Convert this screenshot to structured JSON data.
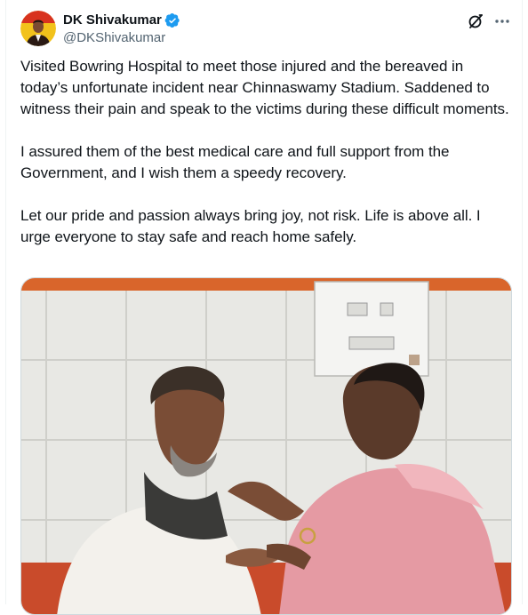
{
  "tweet": {
    "author": {
      "display_name": "DK Shivakumar",
      "handle": "@DKShivakumar",
      "verified": true
    },
    "text": "Visited Bowring Hospital to meet those injured and the bereaved in today’s unfortunate incident near Chinnaswamy Stadium. Saddened to witness their pain and speak to the victims during these difficult moments.\n\nI assured them of the best medical care and full support from the Government, and I wish them a speedy recovery.\n\nLet our pride and passion always bring joy, not risk. Life is above all. I urge everyone to stay safe and reach home safely.",
    "media": {
      "type": "photo",
      "icon": "photo-image"
    }
  },
  "icons": {
    "verified": "verified-badge-icon",
    "grok": "grok-icon",
    "more": "more-options-icon"
  },
  "colors": {
    "text_primary": "#0f1419",
    "text_secondary": "#536471",
    "verified_blue": "#1d9bf0",
    "border": "#cfd9de"
  }
}
